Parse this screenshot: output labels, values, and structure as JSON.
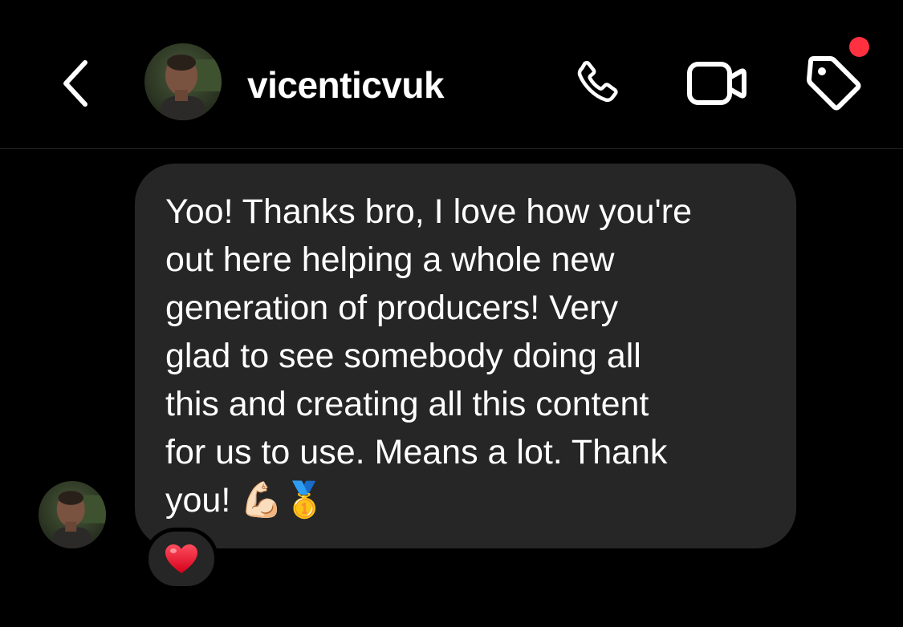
{
  "header": {
    "username": "vicenticvuk",
    "back_icon": "chevron-left-icon",
    "call_icon": "phone-icon",
    "video_icon": "video-camera-icon",
    "tag_icon": "tag-icon",
    "notification_dot_color": "#ff3040"
  },
  "message": {
    "text": "Yoo! Thanks bro, I love how you're\nout here helping a whole new\ngeneration of producers! Very\nglad to see somebody doing all\nthis and creating all this content\nfor us to use. Means a lot. Thank\nyou! 💪🏻🥇",
    "sender_avatar": "avatar",
    "reaction": "❤️"
  },
  "colors": {
    "background": "#000000",
    "bubble": "#262626",
    "text": "#ffffff"
  }
}
